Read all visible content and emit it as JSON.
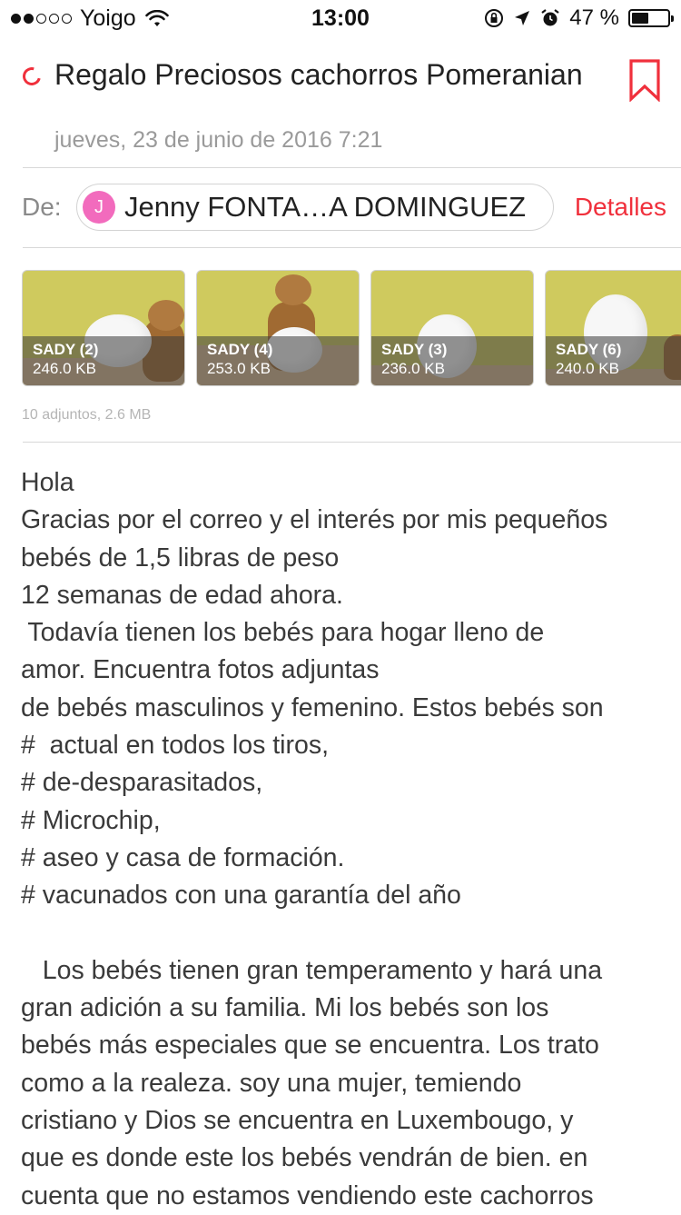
{
  "status_bar": {
    "carrier": "Yoigo",
    "time": "13:00",
    "battery_percent": "47 %",
    "battery_level": 0.47,
    "signal_bars_filled": 2,
    "signal_bars_total": 5
  },
  "message": {
    "subject": "Regalo Preciosos cachorros Pomeranian",
    "date": "jueves, 23 de junio de 2016 7:21",
    "from_label": "De:",
    "avatar_initial": "J",
    "sender_name": "Jenny FONTA…A DOMINGUEZ",
    "details_label": "Detalles",
    "attachments": [
      {
        "name": "SADY (2)",
        "size": "246.0 KB"
      },
      {
        "name": "SADY (4)",
        "size": "253.0 KB"
      },
      {
        "name": "SADY (3)",
        "size": "236.0 KB"
      },
      {
        "name": "SADY (6)",
        "size": "240.0 KB"
      }
    ],
    "attachments_summary": "10 adjuntos, 2.6 MB",
    "body_lines": [
      "Hola",
      "Gracias por el correo y el interés por mis pequeños",
      "bebés de 1,5 libras de peso",
      "12 semanas de edad ahora.",
      " Todavía tienen los bebés para hogar lleno de",
      "amor. Encuentra fotos adjuntas",
      "de bebés masculinos y femenino. Estos bebés son",
      "#  actual en todos los tiros,",
      "# de-desparasitados,",
      "# Microchip,",
      "# aseo y casa de formación.",
      "# vacunados con una garantía del año",
      "",
      "   Los bebés tienen gran temperamento y hará una",
      "gran adición a su familia. Mi los bebés son los",
      "bebés más especiales que se encuentra. Los trato",
      "como a la realeza. soy una mujer, temiendo",
      "cristiano y Dios se encuentra en Luxembougo, y",
      "que es donde este los bebés vendrán de bien. en",
      "cuenta que no estamos vendiendo este cachorros"
    ]
  },
  "colors": {
    "accent_red": "#f0303c",
    "avatar_pink": "#f26bbd",
    "muted_gray": "#9a9a9a"
  },
  "icons": [
    "wifi-icon",
    "orientation-lock-icon",
    "location-arrow-icon",
    "alarm-icon",
    "battery-icon",
    "unread-dot-icon",
    "bookmark-icon"
  ]
}
